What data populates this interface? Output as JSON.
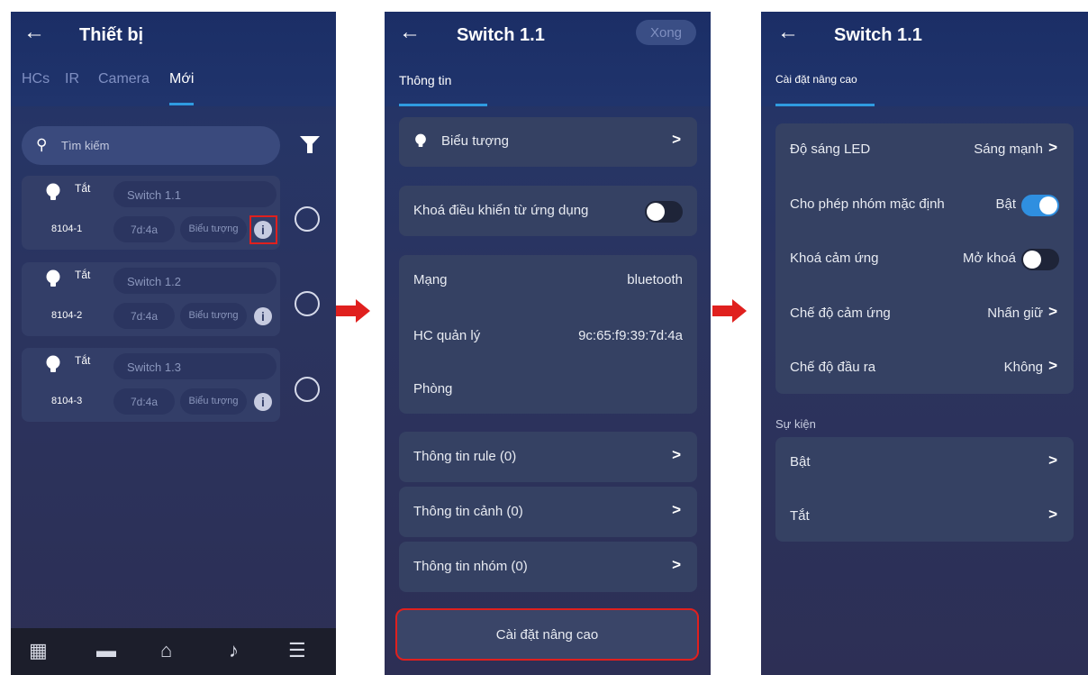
{
  "colors": {
    "accent": "#2f9be0",
    "highlight": "#e0201e",
    "card": "#354163"
  },
  "screen1": {
    "title": "Thiết bị",
    "tabs": [
      "HCs",
      "IR",
      "Camera",
      "Mới"
    ],
    "active_tab": "Mới",
    "search_placeholder": "Tìm kiếm",
    "devices": [
      {
        "state": "Tắt",
        "name": "Switch 1.1",
        "code": "8104-1",
        "mac": "7d:4a",
        "icon_label": "Biểu tượng"
      },
      {
        "state": "Tắt",
        "name": "Switch 1.2",
        "code": "8104-2",
        "mac": "7d:4a",
        "icon_label": "Biểu tượng"
      },
      {
        "state": "Tắt",
        "name": "Switch 1.3",
        "code": "8104-3",
        "mac": "7d:4a",
        "icon_label": "Biểu tượng"
      }
    ],
    "nav_icons": [
      "grid-icon",
      "list-icon",
      "home-icon",
      "music-icon",
      "menu-icon"
    ]
  },
  "screen2": {
    "title": "Switch 1.1",
    "done_label": "Xong",
    "tab": "Thông tin",
    "icon_row": "Biểu tượng",
    "lock_app": "Khoá điều khiển từ ứng dụng",
    "network_label": "Mạng",
    "network_value": "bluetooth",
    "hc_label": "HC quản lý",
    "hc_value": "9c:65:f9:39:7d:4a",
    "room_label": "Phòng",
    "rule_info": "Thông tin rule (0)",
    "scene_info": "Thông tin cảnh (0)",
    "group_info": "Thông tin nhóm (0)",
    "advanced_button": "Cài đặt nâng cao"
  },
  "screen3": {
    "title": "Switch 1.1",
    "tab": "Cài đặt nâng cao",
    "led_label": "Độ sáng LED",
    "led_value": "Sáng mạnh",
    "group_label": "Cho phép nhóm mặc định",
    "group_value": "Bật",
    "touch_lock_label": "Khoá cảm ứng",
    "touch_lock_value": "Mở khoá",
    "touch_mode_label": "Chế độ cảm ứng",
    "touch_mode_value": "Nhấn giữ",
    "output_label": "Chế độ đầu ra",
    "output_value": "Không",
    "events_title": "Sự kiện",
    "event_on": "Bật",
    "event_off": "Tắt"
  }
}
